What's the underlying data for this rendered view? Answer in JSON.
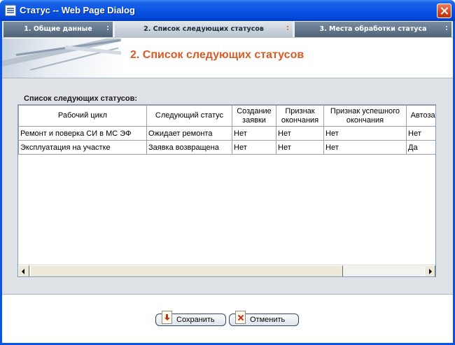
{
  "window": {
    "title": "Статус -- Web Page Dialog"
  },
  "tabs": [
    {
      "label": "1. Общие данные",
      "active": false
    },
    {
      "label": "2. Список следующих статусов",
      "active": true
    },
    {
      "label": "3. Места обработки статуса",
      "active": false
    }
  ],
  "header": {
    "title": "2. Список следующих статусов"
  },
  "section": {
    "label": "Список следующих статусов:"
  },
  "grid": {
    "columns": [
      "Рабочий цикл",
      "Следующий статус",
      "Создание заявки",
      "Признак окончания",
      "Признак успешного окончания",
      "Автозаполнение"
    ],
    "rows": [
      [
        "Ремонт и поверка СИ в МС ЭФ",
        "Ожидает ремонта",
        "Нет",
        "Нет",
        "Нет",
        "Нет"
      ],
      [
        "Эксплуатация на участке",
        "Заявка возвращена",
        "Нет",
        "Нет",
        "Нет",
        "Да"
      ]
    ]
  },
  "footer": {
    "save_label": "Сохранить",
    "cancel_label": "Отменить"
  },
  "colors": {
    "titlebar": "#0a54e4",
    "accent_title": "#d85a25",
    "active_tab_handle": "#f27a20",
    "content_bg": "#dfe3e8"
  },
  "icons": {
    "title": "page-icon",
    "close": "close-icon",
    "save": "save-document-icon",
    "cancel": "cancel-document-icon"
  }
}
